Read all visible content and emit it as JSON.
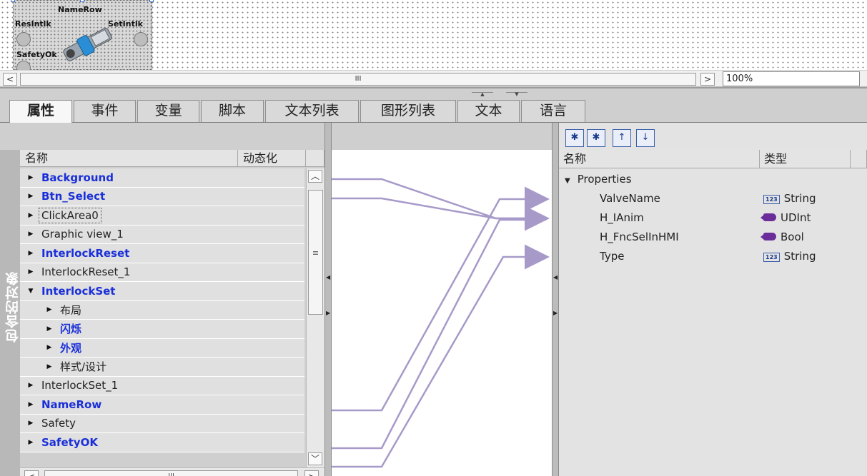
{
  "canvas": {
    "faceplate": {
      "title": "NameRow",
      "left_label": "ResIntlk",
      "right_label": "SetIntlk",
      "bottom_label": "SafetyOk"
    }
  },
  "scrollbar": {
    "left_arrow": "<",
    "right_arrow": ">",
    "grip": "III",
    "zoom_value": "100%"
  },
  "tabs": [
    {
      "label": "属性",
      "active": true
    },
    {
      "label": "事件"
    },
    {
      "label": "变量"
    },
    {
      "label": "脚本"
    },
    {
      "label": "文本列表"
    },
    {
      "label": "图形列表"
    },
    {
      "label": "文本"
    },
    {
      "label": "语言"
    }
  ],
  "left_panel": {
    "side_label": "包含的对象",
    "headers": {
      "name": "名称",
      "dynamic": "动态化"
    },
    "rows": [
      {
        "label": "Background",
        "blue": true,
        "expanded": false,
        "indent": 0
      },
      {
        "label": "Btn_Select",
        "blue": true,
        "expanded": false,
        "indent": 0
      },
      {
        "label": "ClickArea0",
        "blue": false,
        "expanded": false,
        "indent": 0,
        "focused": true
      },
      {
        "label": "Graphic view_1",
        "blue": false,
        "expanded": false,
        "indent": 0
      },
      {
        "label": "InterlockReset",
        "blue": true,
        "expanded": false,
        "indent": 0
      },
      {
        "label": "InterlockReset_1",
        "blue": false,
        "expanded": false,
        "indent": 0
      },
      {
        "label": "InterlockSet",
        "blue": true,
        "expanded": true,
        "indent": 0
      },
      {
        "label": "布局",
        "blue": false,
        "expanded": false,
        "indent": 1
      },
      {
        "label": "闪烁",
        "blue": true,
        "expanded": false,
        "indent": 1
      },
      {
        "label": "外观",
        "blue": true,
        "expanded": false,
        "indent": 1
      },
      {
        "label": "样式/设计",
        "blue": false,
        "expanded": false,
        "indent": 1
      },
      {
        "label": "InterlockSet_1",
        "blue": false,
        "expanded": false,
        "indent": 0
      },
      {
        "label": "NameRow",
        "blue": true,
        "expanded": false,
        "indent": 0
      },
      {
        "label": "Safety",
        "blue": false,
        "expanded": false,
        "indent": 0
      },
      {
        "label": "SafetyOK",
        "blue": true,
        "expanded": false,
        "indent": 0
      }
    ]
  },
  "right_panel": {
    "headers": {
      "name": "名称",
      "type": "类型"
    },
    "group": "Properties",
    "properties": [
      {
        "name": "ValveName",
        "type": "String",
        "icon": "string-type-icon"
      },
      {
        "name": "H_IAnim",
        "type": "UDInt",
        "icon": "udint-type-icon"
      },
      {
        "name": "H_FncSelInHMI",
        "type": "Bool",
        "icon": "udint-type-icon"
      },
      {
        "name": "Type",
        "type": "String",
        "icon": "string-type-icon"
      }
    ]
  },
  "colors": {
    "blue_link": "#1a2fd9",
    "connector": "#a79ac9",
    "udint_icon": "#6a2d9a"
  }
}
